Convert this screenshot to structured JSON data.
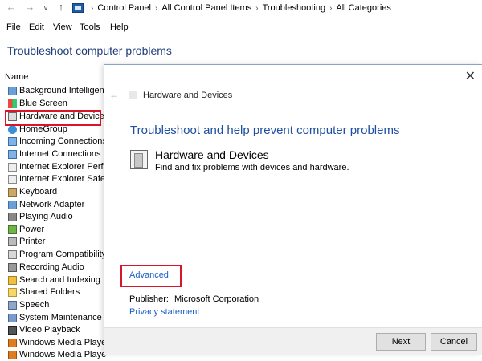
{
  "address_bar": {
    "breadcrumbs": [
      "Control Panel",
      "All Control Panel Items",
      "Troubleshooting",
      "All Categories"
    ]
  },
  "menu": {
    "items": [
      "File",
      "Edit",
      "View",
      "Tools",
      "Help"
    ]
  },
  "panel": {
    "title": "Troubleshoot computer problems",
    "column_header": "Name",
    "items": [
      {
        "label": "Background Intelligent T",
        "icon": "bits-icon"
      },
      {
        "label": "Blue Screen",
        "icon": "windows-flag-icon"
      },
      {
        "label": "Hardware and Devices",
        "icon": "hardware-icon"
      },
      {
        "label": "HomeGroup",
        "icon": "homegroup-icon"
      },
      {
        "label": "Incoming Connections",
        "icon": "network-icon"
      },
      {
        "label": "Internet Connections",
        "icon": "network-icon"
      },
      {
        "label": "Internet Explorer Perform",
        "icon": "ie-icon"
      },
      {
        "label": "Internet Explorer Safety",
        "icon": "ie-icon"
      },
      {
        "label": "Keyboard",
        "icon": "keyboard-icon"
      },
      {
        "label": "Network Adapter",
        "icon": "network-adapter-icon"
      },
      {
        "label": "Playing Audio",
        "icon": "audio-icon"
      },
      {
        "label": "Power",
        "icon": "power-icon"
      },
      {
        "label": "Printer",
        "icon": "printer-icon"
      },
      {
        "label": "Program Compatibility T",
        "icon": "compat-icon"
      },
      {
        "label": "Recording Audio",
        "icon": "microphone-icon"
      },
      {
        "label": "Search and Indexing",
        "icon": "search-icon"
      },
      {
        "label": "Shared Folders",
        "icon": "folder-icon"
      },
      {
        "label": "Speech",
        "icon": "speech-icon"
      },
      {
        "label": "System Maintenance",
        "icon": "maintenance-icon"
      },
      {
        "label": "Video Playback",
        "icon": "video-icon"
      },
      {
        "label": "Windows Media Player D",
        "icon": "media-player-icon"
      },
      {
        "label": "Windows Media Playe",
        "icon": "media-player-icon"
      }
    ]
  },
  "dialog": {
    "breadcrumb": "Hardware and Devices",
    "heading": "Troubleshoot and help prevent computer problems",
    "item_title": "Hardware and Devices",
    "item_description": "Find and fix problems with devices and hardware.",
    "advanced_link": "Advanced",
    "publisher_label": "Publisher:",
    "publisher_value": "Microsoft Corporation",
    "privacy_link": "Privacy statement",
    "next_button": "Next",
    "cancel_button": "Cancel",
    "close_glyph": "✕",
    "back_glyph": "←"
  },
  "colors": {
    "highlight": "#d9152b",
    "link": "#1a5fc6",
    "heading": "#1e4fa0",
    "page_title": "#1e3d7a"
  }
}
